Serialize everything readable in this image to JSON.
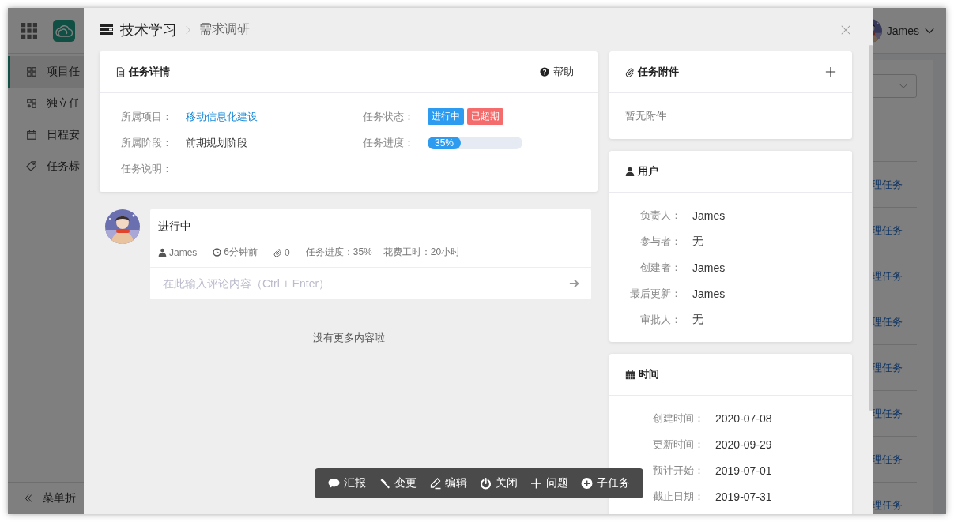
{
  "app": {
    "sidebar": {
      "items": [
        {
          "label": "项目任",
          "selected": true
        },
        {
          "label": "独立任",
          "selected": false
        },
        {
          "label": "日程安",
          "selected": false
        },
        {
          "label": "任务标",
          "selected": false
        }
      ],
      "collapse_label": "菜单折"
    },
    "user": {
      "name": "James"
    },
    "links": [
      "理任务",
      "理任务",
      "理任务",
      "理任务",
      "理任务",
      "理任务",
      "理任务",
      "理任务"
    ]
  },
  "dialog": {
    "breadcrumb": [
      "技术学习",
      "需求调研"
    ],
    "details": {
      "title": "任务详情",
      "help": "帮助",
      "fields": [
        {
          "kind": "link",
          "label": "所属项目：",
          "value": "移动信息化建设"
        },
        {
          "kind": "tags",
          "label": "任务状态：",
          "tags": [
            {
              "text": "进行中",
              "color": "#2d9cf0"
            },
            {
              "text": "已超期",
              "color": "#f56c6c"
            }
          ]
        },
        {
          "kind": "text",
          "label": "所属阶段：",
          "value": "前期规划阶段"
        },
        {
          "kind": "progress",
          "label": "任务进度：",
          "level": 0.35,
          "reading": "35%"
        },
        {
          "kind": "text",
          "label": "任务说明："
        }
      ]
    },
    "comment": {
      "status": "进行中",
      "user": "James",
      "time": "6分钟前",
      "attachments": "0",
      "progress": "任务进度：35%",
      "hours": "花费工时：20小时",
      "placeholder": "在此输入评论内容（Ctrl + Enter）"
    },
    "footer": "没有更多内容啦",
    "attachments": {
      "title": "任务附件",
      "empty": "暂无附件"
    },
    "users": {
      "title": "用户",
      "rows": [
        {
          "label": "负责人：",
          "value": "James"
        },
        {
          "label": "参与者：",
          "value": "无"
        },
        {
          "label": "创建者：",
          "value": "James"
        },
        {
          "label": "最后更新：",
          "value": "James"
        },
        {
          "label": "审批人：",
          "value": "无"
        }
      ]
    },
    "time": {
      "title": "时间",
      "rows": [
        {
          "label": "创建时间：",
          "value": "2020-07-08"
        },
        {
          "label": "更新时间：",
          "value": "2020-09-29"
        },
        {
          "label": "预计开始：",
          "value": "2019-07-01"
        },
        {
          "label": "截止日期：",
          "value": "2019-07-31"
        }
      ]
    },
    "actions": [
      "汇报",
      "变更",
      "编辑",
      "关闭",
      "问题",
      "子任务"
    ]
  }
}
